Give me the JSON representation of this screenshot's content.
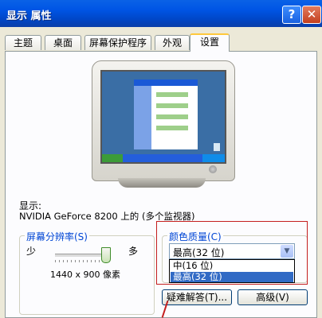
{
  "window": {
    "title": "显示 属性",
    "help_symbol": "?",
    "close_symbol": "✕"
  },
  "tabs": [
    {
      "label": "主题"
    },
    {
      "label": "桌面"
    },
    {
      "label": "屏幕保护程序"
    },
    {
      "label": "外观"
    },
    {
      "label": "设置",
      "active": true
    }
  ],
  "display": {
    "label": "显示:",
    "value": "NVIDIA GeForce 8200 上的 (多个监视器)"
  },
  "resolution": {
    "title": "屏幕分辨率(S)",
    "less_label": "少",
    "more_label": "多",
    "value": "1440 x 900 像素",
    "slider_level": 1.0
  },
  "color_quality": {
    "title": "颜色质量(C)",
    "selected": "最高(32 位)",
    "options": [
      "中(16 位)",
      "最高(32 位)"
    ],
    "selected_index": 1
  },
  "buttons": {
    "troubleshoot": "疑难解答(T)...",
    "advanced": "高级(V)"
  },
  "colors": {
    "title_bar": "#0055e5",
    "selection": "#316ac5",
    "highlight_box": "#c41e1e",
    "group_title": "#0046d5"
  }
}
